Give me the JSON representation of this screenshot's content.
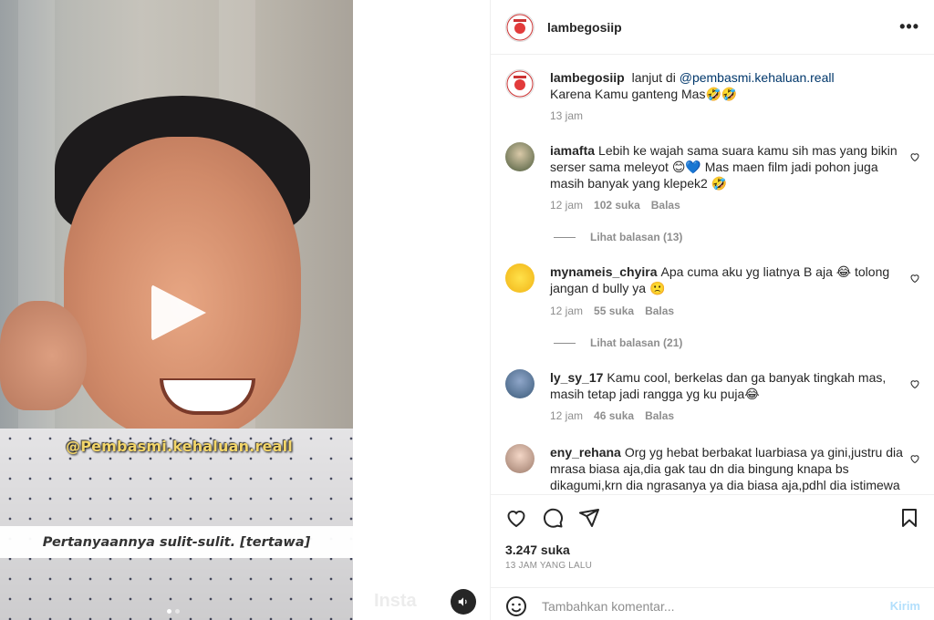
{
  "media": {
    "watermark": "@Pembasmi.kehaluan.reall",
    "caption": "Pertanyaannya sulit-sulit. [tertawa]",
    "faint_watermark": "Insta"
  },
  "post": {
    "username": "lambegosiip",
    "more_label": "•••",
    "caption": {
      "username": "lambegosiip",
      "prefix": "lanjut di",
      "mention": "@pembasmi.kehaluan.reall",
      "line2": "Karena Kamu ganteng Mas🤣🤣",
      "time": "13 jam"
    },
    "comments": [
      {
        "username": "iamafta",
        "text": "Lebih ke wajah sama suara kamu sih mas yang bikin serser sama meleyot 😊💙 Mas maen film jadi pohon juga masih banyak yang klepek2 🤣",
        "time": "12 jam",
        "likes": "102 suka",
        "reply": "Balas",
        "view_replies": "Lihat balasan (13)"
      },
      {
        "username": "mynameis_chyira",
        "text": "Apa cuma aku yg liatnya B aja 😂 tolong jangan d bully ya 🙁",
        "time": "12 jam",
        "likes": "55 suka",
        "reply": "Balas",
        "view_replies": "Lihat balasan (21)"
      },
      {
        "username": "ly_sy_17",
        "text": "Kamu cool, berkelas dan ga banyak tingkah mas, masih tetap jadi rangga yg ku puja😂",
        "time": "12 jam",
        "likes": "46 suka",
        "reply": "Balas"
      },
      {
        "username": "eny_rehana",
        "text": "Org yg hebat berbakat luarbiasa ya gini,justru dia mrasa biasa aja,dia gak tau dn dia bingung knapa bs dikagumi,krn dia ngrasanya ya dia biasa aja,pdhl dia istimewa"
      }
    ],
    "likes_count": "3.247 suka",
    "time_ago": "13 JAM YANG LALU",
    "comment_placeholder": "Tambahkan komentar...",
    "send_label": "Kirim"
  },
  "icons": [
    "play-icon",
    "sound-icon",
    "heart-icon",
    "comment-icon",
    "share-icon",
    "bookmark-icon",
    "emoji-icon",
    "more-icon"
  ]
}
